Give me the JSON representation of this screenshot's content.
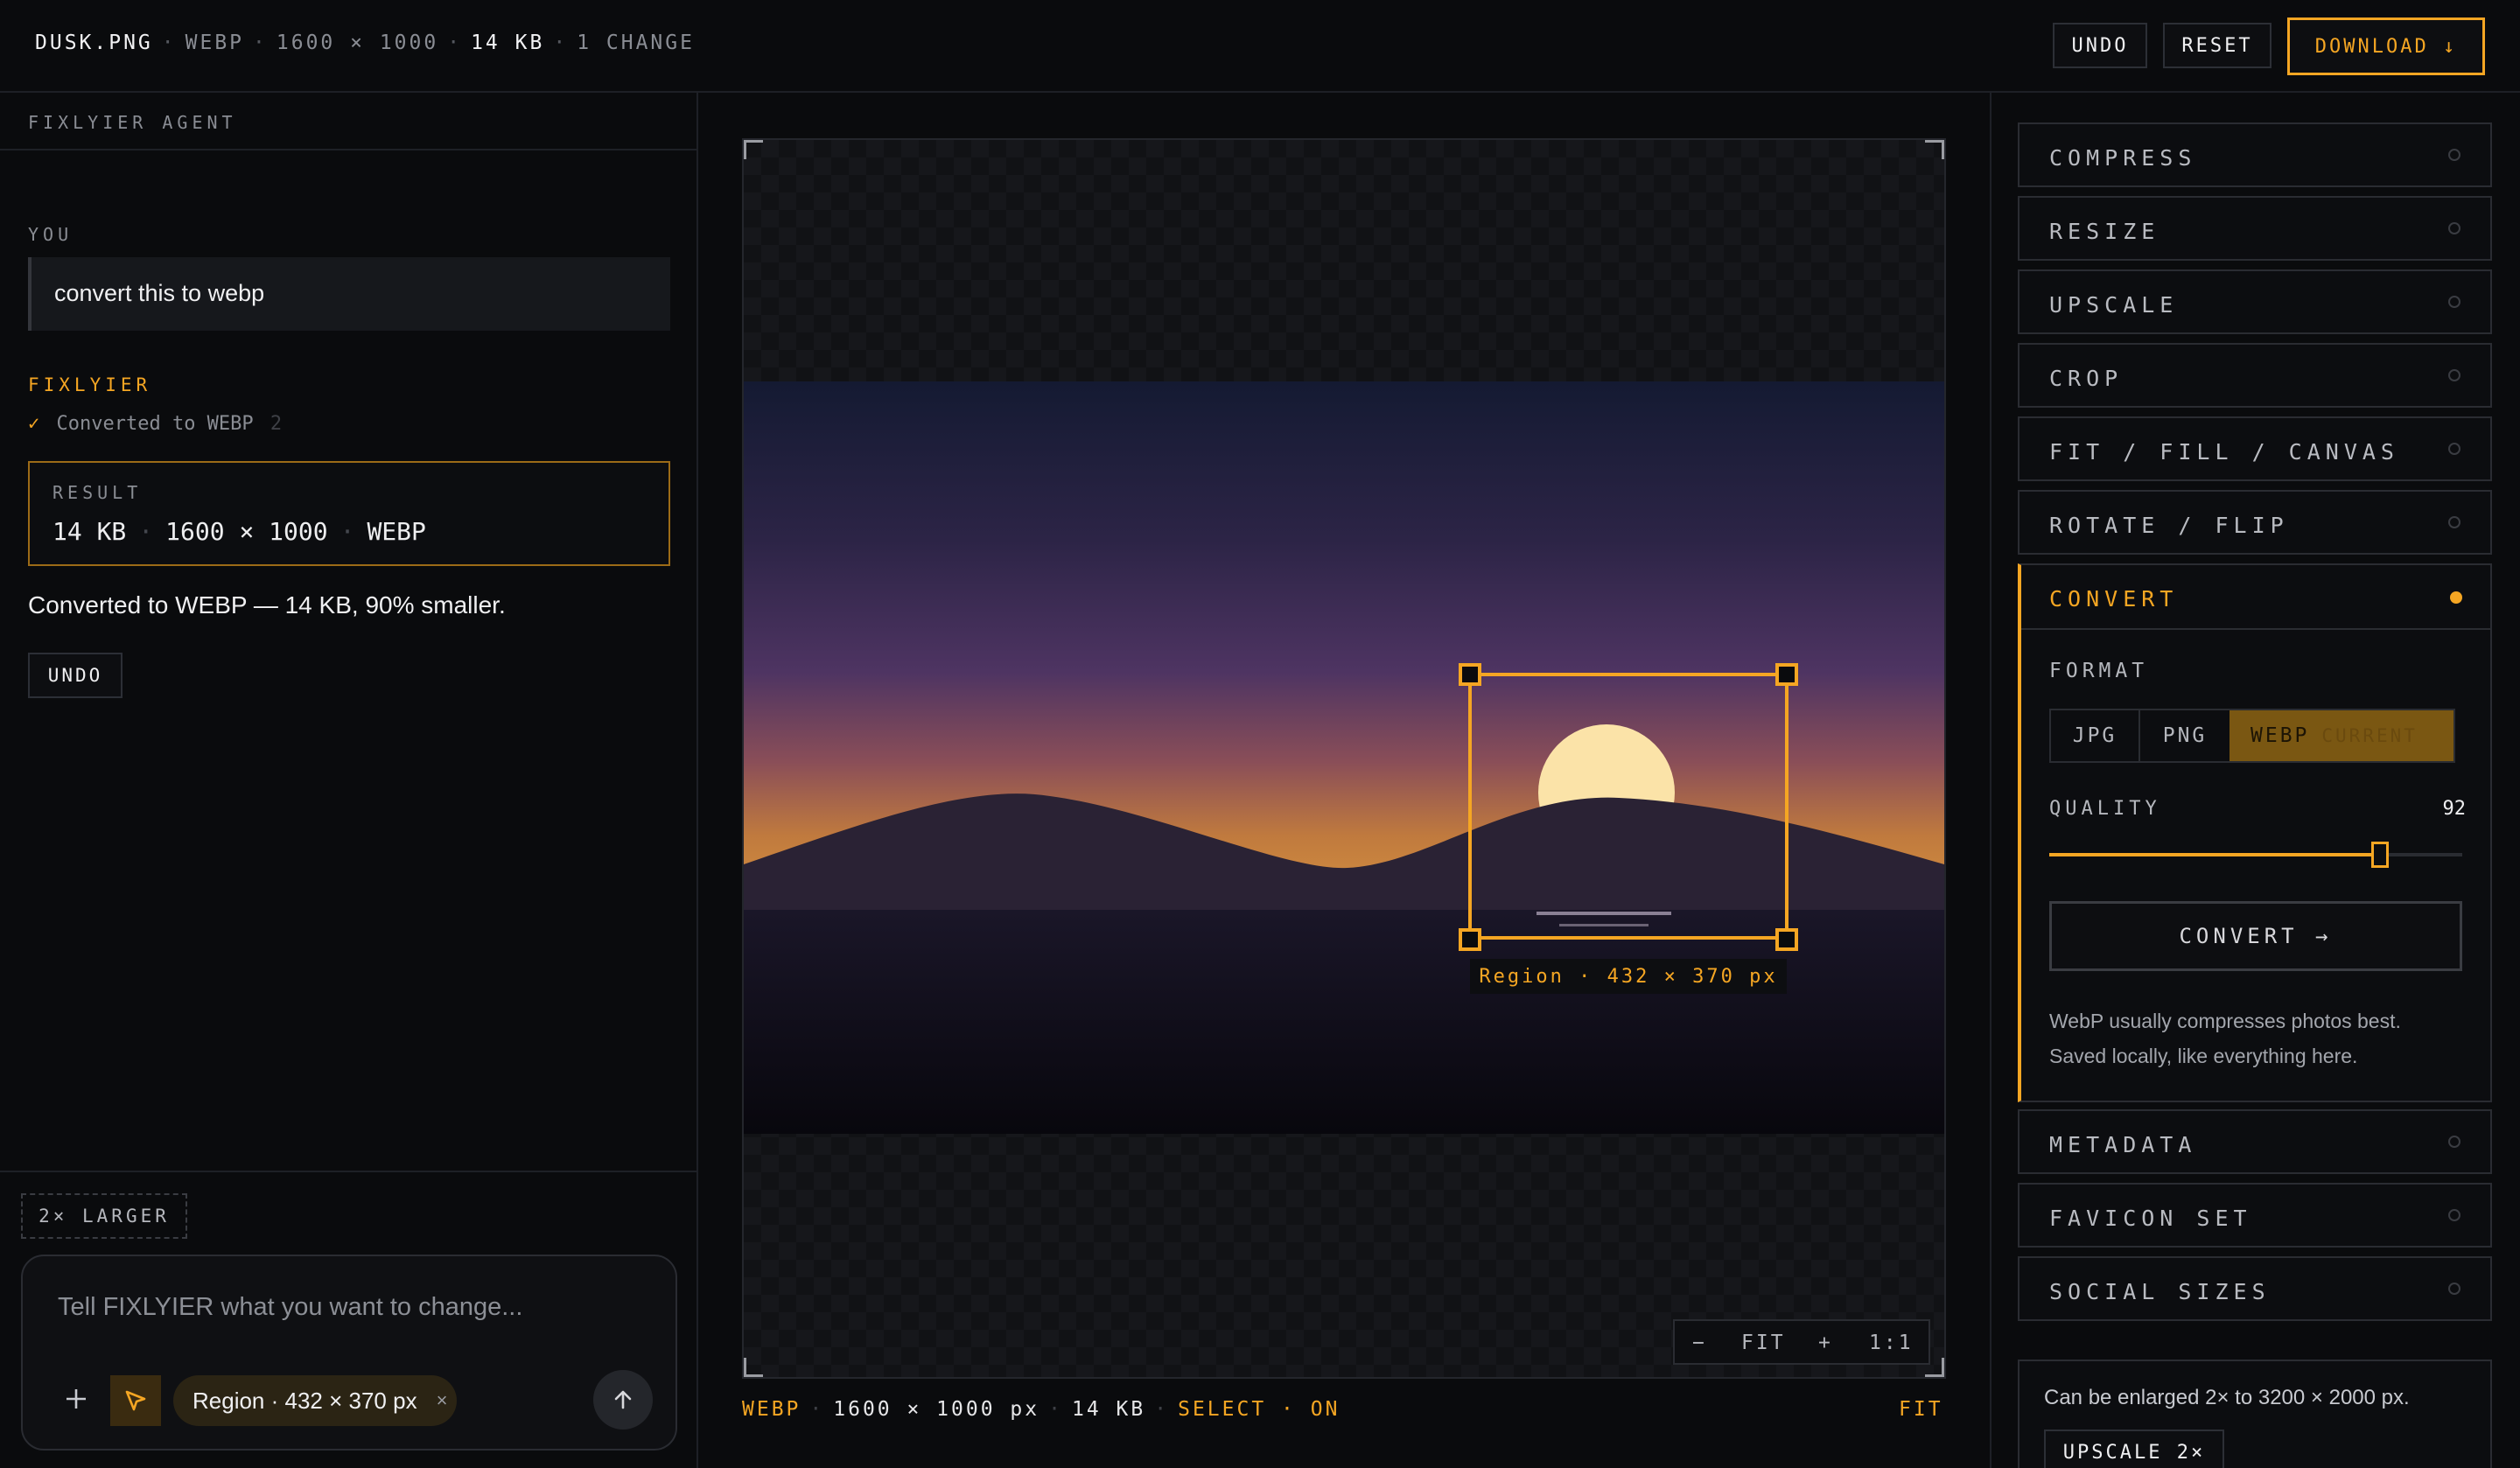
{
  "topbar": {
    "file_name": "DUSK.PNG",
    "format": "WEBP",
    "dimensions": "1600 × 1000",
    "size": "14 KB",
    "changes": "1 CHANGE",
    "undo_label": "UNDO",
    "reset_label": "RESET",
    "download_label": "DOWNLOAD ↓"
  },
  "agent": {
    "header": "FIXLYIER AGENT",
    "user_label": "YOU",
    "user_message": "convert this to webp",
    "assistant_label": "FIXLYIER",
    "status_check": "✓",
    "status_text": "Converted to WEBP",
    "status_count": "2",
    "result_label": "RESULT",
    "result_size": "14 KB",
    "result_dims": "1600 × 1000",
    "result_format": "WEBP",
    "summary": "Converted to WEBP — 14 KB, 90% smaller.",
    "undo_label": "UNDO",
    "suggestion_chip": "2× LARGER",
    "input_placeholder": "Tell FIXLYIER what you want to change...",
    "add_icon": "plus-icon",
    "select_icon": "cursor-arrow-icon",
    "region_chip": "Region · 432 × 370 px",
    "region_chip_close": "×",
    "send_icon": "arrow-up-icon"
  },
  "canvas": {
    "selection_label": "Region · 432 × 370 px",
    "zoom_out": "−",
    "zoom_fit": "FIT",
    "zoom_in": "+",
    "zoom_actual": "1:1",
    "status_format": "WEBP",
    "status_dims": "1600 × 1000 px",
    "status_size": "14 KB",
    "status_select": "SELECT · ON",
    "status_fit": "FIT"
  },
  "tools": {
    "items": [
      {
        "label": "COMPRESS"
      },
      {
        "label": "RESIZE"
      },
      {
        "label": "UPSCALE"
      },
      {
        "label": "CROP"
      },
      {
        "label": "FIT / FILL / CANVAS"
      },
      {
        "label": "ROTATE / FLIP"
      }
    ],
    "active": {
      "label": "CONVERT",
      "format_label": "FORMAT",
      "formats": [
        "JPG",
        "PNG",
        "WEBP"
      ],
      "selected_format": "WEBP",
      "selected_note": "CURRENT",
      "quality_label": "QUALITY",
      "quality_value": "92",
      "quality_fraction": 0.8,
      "convert_button": "CONVERT →",
      "note_line1": "WebP usually compresses photos best.",
      "note_line2": "Saved locally, like everything here."
    },
    "after_items": [
      {
        "label": "METADATA"
      },
      {
        "label": "FAVICON SET"
      },
      {
        "label": "SOCIAL SIZES"
      }
    ],
    "upscale_hint": "Can be enlarged 2× to 3200 × 2000 px.",
    "upscale_button": "UPSCALE 2×"
  },
  "colors": {
    "accent": "#f5a623",
    "background": "#0a0b0d"
  }
}
